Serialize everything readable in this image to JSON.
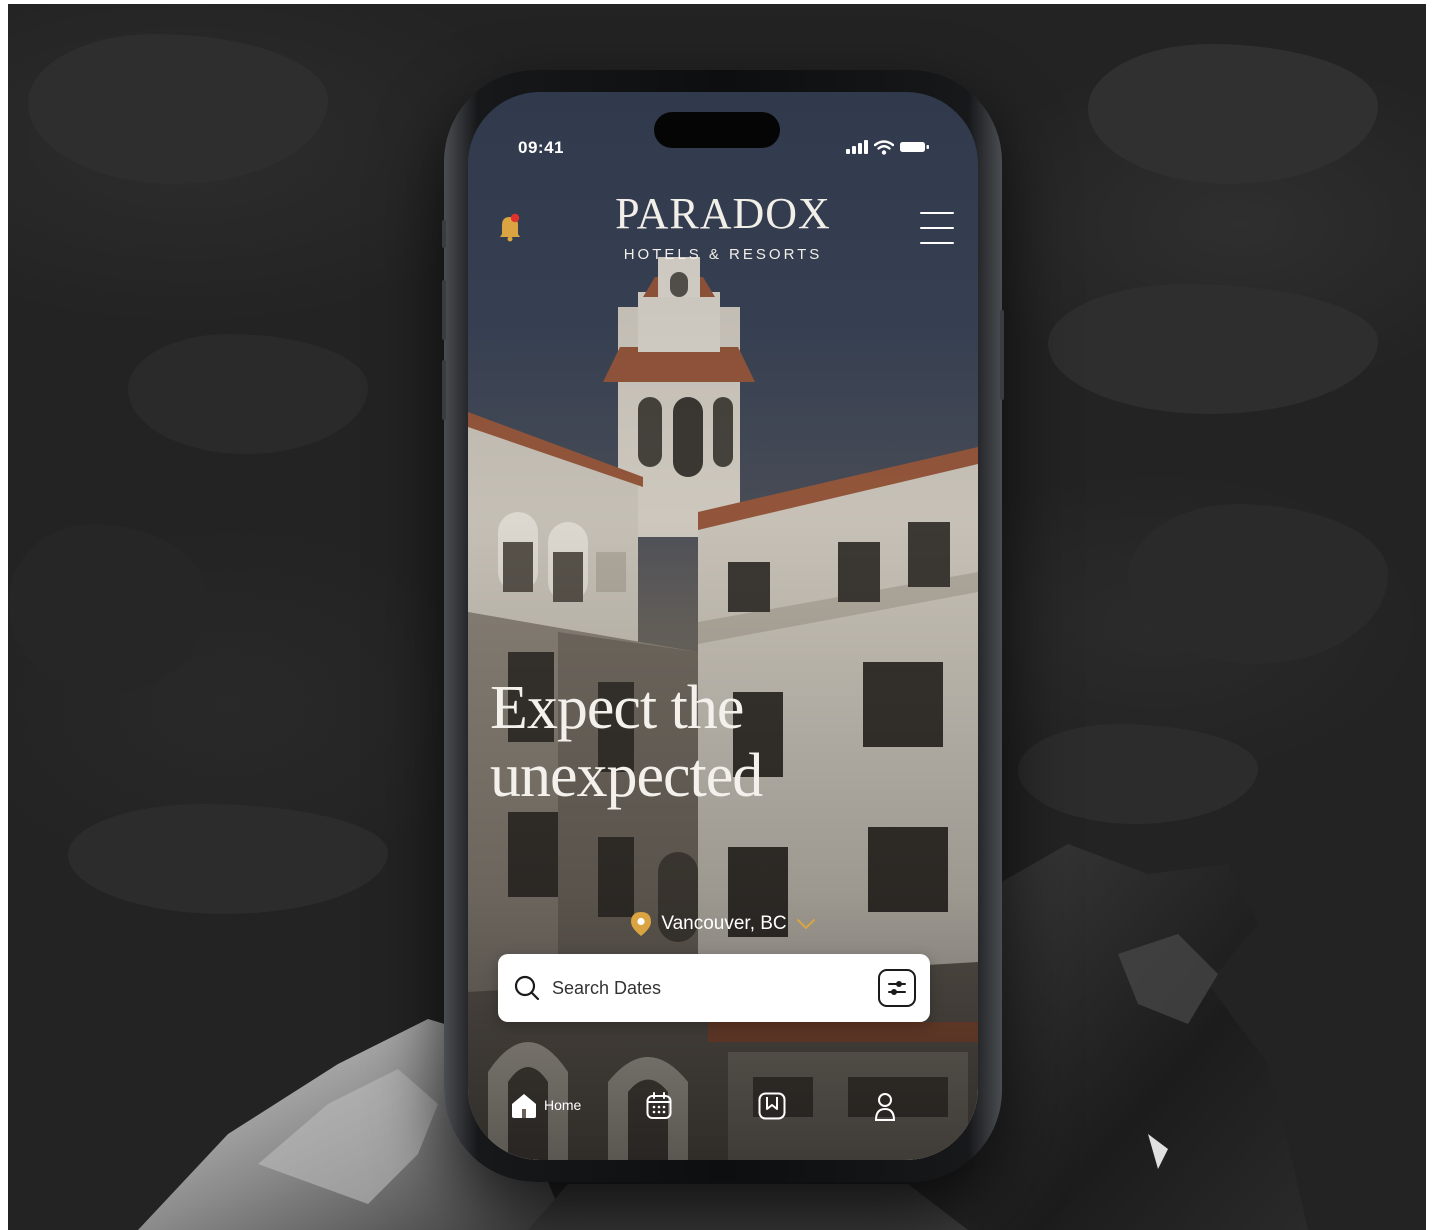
{
  "status_bar": {
    "time": "09:41"
  },
  "header": {
    "brand_name": "PARADOX",
    "brand_subtitle": "HOTELS & RESORTS",
    "notification_icon": "bell-icon",
    "menu_icon": "hamburger-menu-icon"
  },
  "hero": {
    "headline_line1": "Expect the",
    "headline_line2": "unexpected"
  },
  "location": {
    "value": "Vancouver, BC",
    "pin_icon": "location-pin-icon",
    "dropdown_icon": "chevron-down-icon"
  },
  "search": {
    "placeholder": "Search Dates",
    "icon": "search-icon",
    "filter_icon": "sliders-icon"
  },
  "tabbar": {
    "items": [
      {
        "label": "Home",
        "icon": "home-icon",
        "active": true
      },
      {
        "label": "",
        "icon": "calendar-icon",
        "active": false
      },
      {
        "label": "",
        "icon": "bookmark-icon",
        "active": false
      },
      {
        "label": "",
        "icon": "profile-icon",
        "active": false
      }
    ]
  },
  "colors": {
    "accent_gold": "#d9a441",
    "notification_dot": "#e0322b",
    "text_light": "#f2efe9",
    "search_bg": "#ffffff"
  }
}
